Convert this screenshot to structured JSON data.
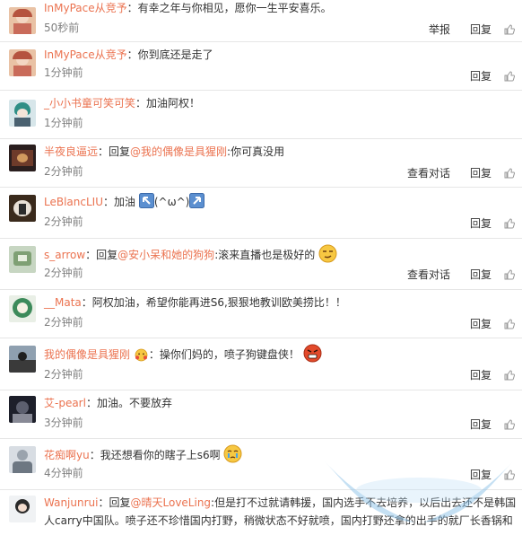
{
  "comments": [
    {
      "user": "InMyPace从竞予",
      "pre": "",
      "mention": "",
      "text": "：有幸之年与你相见，愿你一生平安喜乐。",
      "time": "50秒前",
      "actions": [
        "举报",
        "回复"
      ]
    },
    {
      "user": "InMyPace从竞予",
      "pre": "",
      "mention": "",
      "text": "：你到底还是走了",
      "time": "1分钟前",
      "actions": [
        "回复"
      ]
    },
    {
      "user": "_小小书童可笑可笑",
      "pre": "",
      "mention": "",
      "text": "：加油阿权！",
      "time": "1分钟前",
      "actions": [
        "回复"
      ]
    },
    {
      "user": "半夜良逼远",
      "pre": "：回复",
      "mention": "@我的偶像是具猩刚",
      "text": ":你可真没用",
      "time": "2分钟前",
      "actions": [
        "查看对话",
        "回复"
      ]
    },
    {
      "user": "LeBlancLIU",
      "pre": "：加油",
      "mention": "",
      "text": "(^ω^)",
      "time": "2分钟前",
      "actions": [
        "回复"
      ]
    },
    {
      "user": "s_arrow",
      "pre": "：回复",
      "mention": "@安小呆和她的狗狗",
      "text": ":滚来直播也是极好的",
      "time": "2分钟前",
      "actions": [
        "查看对话",
        "回复"
      ]
    },
    {
      "user": "__Mata",
      "pre": "",
      "mention": "",
      "text": "：阿权加油，希望你能再进S6,狠狠地教训欧美捞比！！",
      "time": "2分钟前",
      "actions": [
        "回复"
      ]
    },
    {
      "user": "我的偶像是具猩刚",
      "pre": "",
      "mention": "",
      "text": "：操你们妈的，喷子狗键盘侠！",
      "time": "2分钟前",
      "actions": [
        "回复"
      ]
    },
    {
      "user": "艾-pearl",
      "pre": "",
      "mention": "",
      "text": "：加油。不要放弃",
      "time": "3分钟前",
      "actions": [
        "回复"
      ]
    },
    {
      "user": "花痴啊yu",
      "pre": "",
      "mention": "",
      "text": "：我还想看你的瞎子上s6啊",
      "time": "4分钟前",
      "actions": [
        "回复"
      ]
    },
    {
      "user": "Wanjunrui",
      "pre": "：回复",
      "mention": "@晴天LoveLing",
      "text": ":但是打不过就请韩援，国内选手不去培养，以后出去还不是韩国",
      "text2": "人carry中国队。喷子还不珍惜国内打野，稍微状态不好就喷，国内打野还拿的出手的就厂长香锅和",
      "time": "",
      "actions": []
    }
  ],
  "colors": {
    "username": "#eb7350",
    "time": "#808080",
    "divider": "#e6e6e6"
  },
  "icons": {
    "like": "thumbs-up-icon",
    "arrow": "arrow-icon",
    "emoji": "face-emoji-icon"
  }
}
